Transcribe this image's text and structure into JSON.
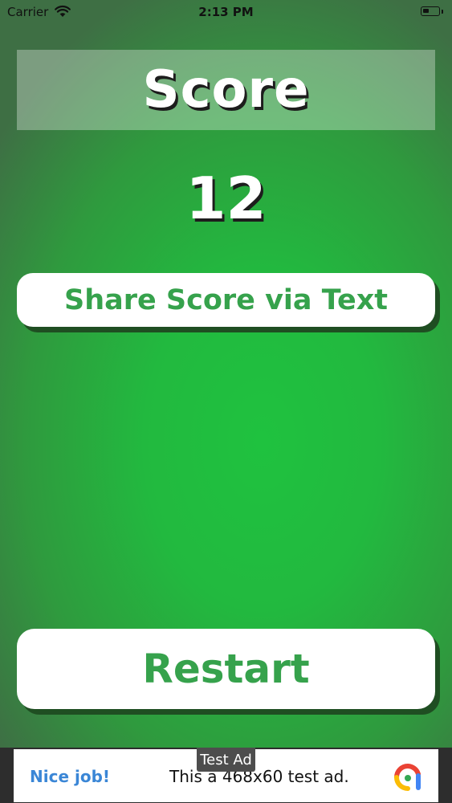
{
  "status_bar": {
    "carrier": "Carrier",
    "time": "2:13 PM",
    "wifi_icon": "wifi-icon",
    "battery_icon": "battery-icon"
  },
  "score_screen": {
    "title": "Score",
    "score_value": "12"
  },
  "buttons": {
    "share_label": "Share Score via Text",
    "restart_label": "Restart"
  },
  "ad": {
    "badge": "Test Ad",
    "headline": "Nice job!",
    "text": "This a 468x60 test ad.",
    "logo_icon": "admob-logo-icon"
  },
  "colors": {
    "background_green": "#22b93f",
    "button_text_green": "#36a24c",
    "button_shadow": "#1f4e22",
    "ad_link_blue": "#3a86d6"
  }
}
